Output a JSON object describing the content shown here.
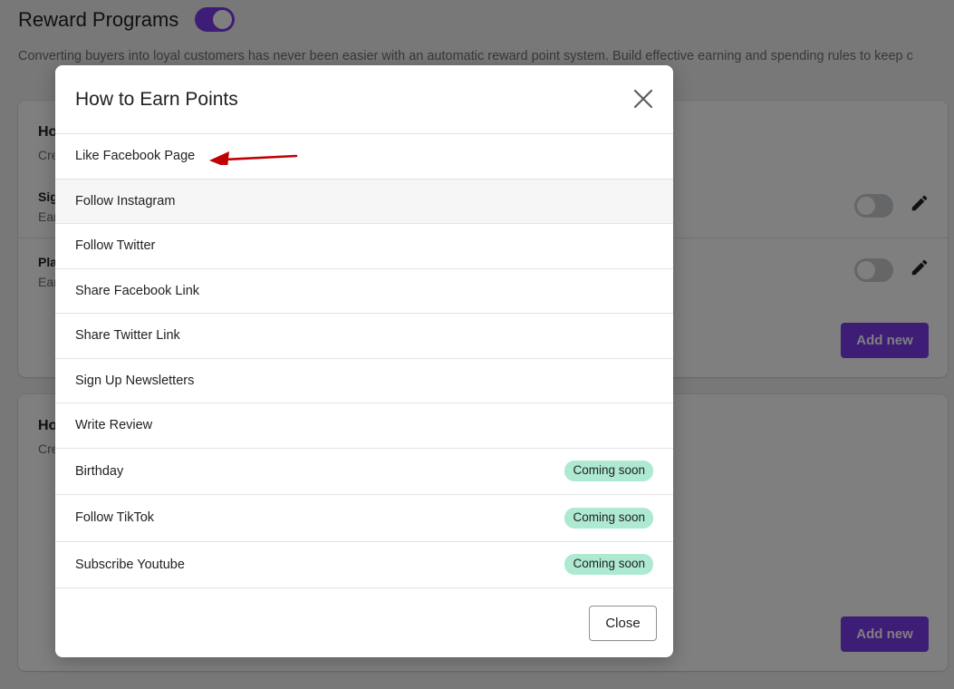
{
  "page": {
    "title": "Reward Programs",
    "description": "Converting buyers into loyal customers has never been easier with an automatic reward point system. Build effective earning and spending rules to keep c",
    "cards": [
      {
        "title": "Ho",
        "subtitle": "Cre",
        "rules": [
          {
            "name": "Sig",
            "desc": "Ear"
          },
          {
            "name": "Pla",
            "desc": "Ear"
          }
        ],
        "add_new_label": "Add new"
      },
      {
        "title": "Ho",
        "subtitle": "Cre",
        "add_new_label": "Add new"
      }
    ]
  },
  "modal": {
    "title": "How to Earn Points",
    "options": [
      {
        "label": "Like Facebook Page",
        "badge": ""
      },
      {
        "label": "Follow Instagram",
        "badge": ""
      },
      {
        "label": "Follow Twitter",
        "badge": ""
      },
      {
        "label": "Share Facebook Link",
        "badge": ""
      },
      {
        "label": "Share Twitter Link",
        "badge": ""
      },
      {
        "label": "Sign Up Newsletters",
        "badge": ""
      },
      {
        "label": "Write Review",
        "badge": ""
      },
      {
        "label": "Birthday",
        "badge": "Coming soon"
      },
      {
        "label": "Follow TikTok",
        "badge": "Coming soon"
      },
      {
        "label": "Subscribe Youtube",
        "badge": "Coming soon"
      }
    ],
    "close_label": "Close"
  },
  "colors": {
    "accent": "#7c3aed",
    "badge_bg": "#aee9d1",
    "arrow": "#c00000"
  },
  "icons": {
    "modal_close": "close-icon",
    "edit": "pencil-icon",
    "annotation": "red-arrow-icon"
  }
}
